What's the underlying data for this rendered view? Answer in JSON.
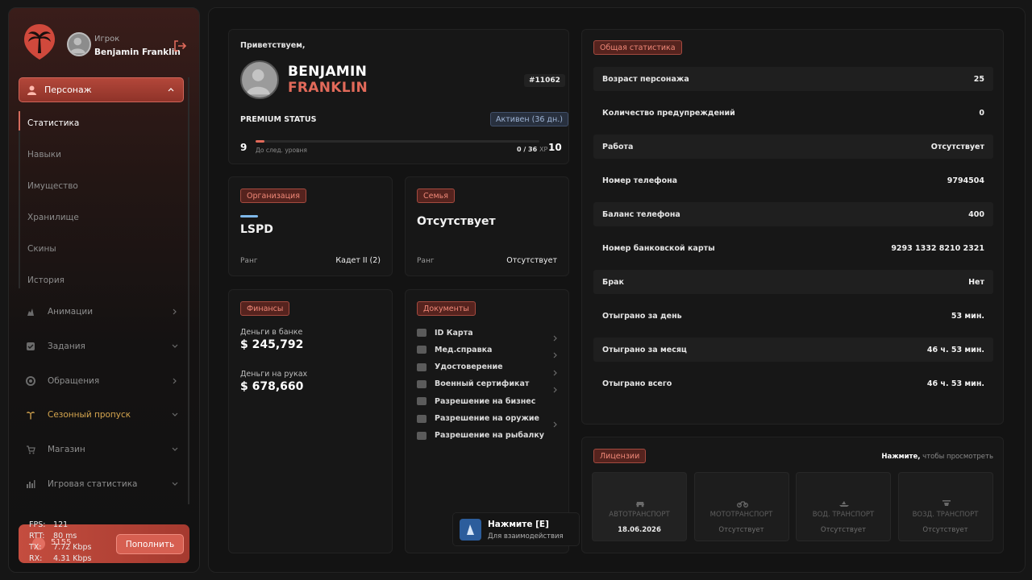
{
  "user": {
    "role": "Игрок",
    "name": "Benjamin Franklin"
  },
  "sidebar": {
    "active": {
      "label": "Персонаж"
    },
    "sub_items": [
      "Статистика",
      "Навыки",
      "Имущество",
      "Хранилище",
      "Скины",
      "История"
    ],
    "items": [
      {
        "label": "Анимации",
        "icon": "animation-icon"
      },
      {
        "label": "Задания",
        "icon": "tasks-icon"
      },
      {
        "label": "Обращения",
        "icon": "support-icon"
      },
      {
        "label": "Сезонный пропуск",
        "icon": "palm-icon"
      },
      {
        "label": "Магазин",
        "icon": "cart-icon"
      },
      {
        "label": "Игровая статистика",
        "icon": "bar-chart-icon"
      }
    ],
    "balance": "5155",
    "topup_label": "Пополнить",
    "perf": [
      {
        "k": "FPS:",
        "v": "121"
      },
      {
        "k": "RTT:",
        "v": "80 ms"
      },
      {
        "k": "TX:",
        "v": "7.72 Kbps"
      },
      {
        "k": "RX:",
        "v": "4.31 Kbps"
      }
    ]
  },
  "profile": {
    "greeting": "Приветствуем,",
    "first_name": "BENJAMIN",
    "last_name": "FRANKLIN",
    "id": "#11062",
    "premium_label": "PREMIUM STATUS",
    "premium_status": "Активен (36 дн.)",
    "level_current": "9",
    "level_next": "10",
    "level_hint": "До след. уровня",
    "xp": "0 / 36",
    "xp_unit": "XP",
    "xp_progress": 0.03
  },
  "organization": {
    "tag": "Организация",
    "name": "LSPD",
    "rank_label": "Ранг",
    "rank": "Кадет II (2)"
  },
  "family": {
    "tag": "Семья",
    "name": "Отсутствует",
    "rank_label": "Ранг",
    "rank": "Отсутствует"
  },
  "finance": {
    "tag": "Финансы",
    "bank_label": "Деньги в банке",
    "bank": "$ 245,792",
    "cash_label": "Деньги на руках",
    "cash": "$ 678,660"
  },
  "documents": {
    "tag": "Документы",
    "items": [
      {
        "label": "ID Карта",
        "arrow": true
      },
      {
        "label": "Мед.справка",
        "arrow": true
      },
      {
        "label": "Удостоверение",
        "arrow": true
      },
      {
        "label": "Военный сертификат",
        "arrow": true
      },
      {
        "label": "Разрешение на бизнес",
        "arrow": false
      },
      {
        "label": "Разрешение на оружие",
        "arrow": true
      },
      {
        "label": "Разрешение на рыбалку",
        "arrow": false
      }
    ]
  },
  "interaction": {
    "title": "Нажмите [E]",
    "subtitle": "Для взаимодействия"
  },
  "stats": {
    "tag": "Общая статистика",
    "rows": [
      {
        "k": "Возраст персонажа",
        "v": "25"
      },
      {
        "k": "Количество предупреждений",
        "v": "0"
      },
      {
        "k": "Работа",
        "v": "Отсутствует"
      },
      {
        "k": "Номер телефона",
        "v": "9794504"
      },
      {
        "k": "Баланс телефона",
        "v": "400"
      },
      {
        "k": "Номер банковской карты",
        "v": "9293 1332 8210 2321"
      },
      {
        "k": "Брак",
        "v": "Нет"
      },
      {
        "k": "Отыграно за день",
        "v": "53 мин."
      },
      {
        "k": "Отыграно за месяц",
        "v": "46 ч. 53 мин."
      },
      {
        "k": "Отыграно всего",
        "v": "46 ч. 53 мин."
      }
    ]
  },
  "licenses": {
    "tag": "Лицензии",
    "hint_bold": "Нажмите,",
    "hint_rest": " чтобы просмотреть",
    "items": [
      {
        "name": "АВТОТРАНСПОРТ",
        "value": "18.06.2026",
        "active": true
      },
      {
        "name": "МОТОТРАНСПОРТ",
        "value": "Отсутствует",
        "active": false
      },
      {
        "name": "ВОД. ТРАНСПОРТ",
        "value": "Отсутствует",
        "active": false
      },
      {
        "name": "ВОЗД. ТРАНСПОРТ",
        "value": "Отсутствует",
        "active": false
      }
    ]
  },
  "colors": {
    "accent": "#e26a5a",
    "premium": "#9fb5d6",
    "gold": "#d6a64f"
  }
}
